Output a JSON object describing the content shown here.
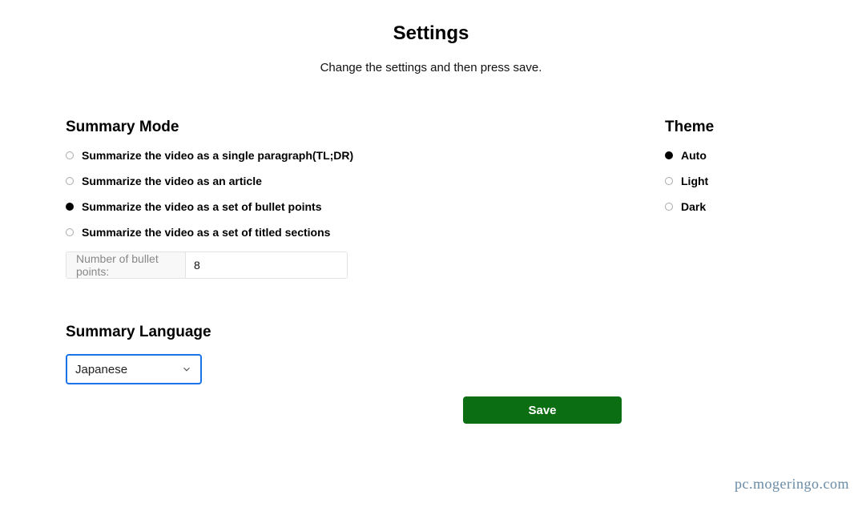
{
  "header": {
    "title": "Settings",
    "subtitle": "Change the settings and then press save."
  },
  "summary_mode": {
    "heading": "Summary Mode",
    "options": [
      {
        "label": "Summarize the video as a single paragraph(TL;DR)",
        "selected": false
      },
      {
        "label": "Summarize the video as an article",
        "selected": false
      },
      {
        "label": "Summarize the video as a set of bullet points",
        "selected": true
      },
      {
        "label": "Summarize the video as a set of titled sections",
        "selected": false
      }
    ],
    "bullet_label": "Number of bullet points:",
    "bullet_value": "8"
  },
  "summary_language": {
    "heading": "Summary Language",
    "value": "Japanese"
  },
  "theme": {
    "heading": "Theme",
    "options": [
      {
        "label": "Auto",
        "selected": true
      },
      {
        "label": "Light",
        "selected": false
      },
      {
        "label": "Dark",
        "selected": false
      }
    ]
  },
  "save_button": "Save",
  "watermark": "pc.mogeringo.com"
}
